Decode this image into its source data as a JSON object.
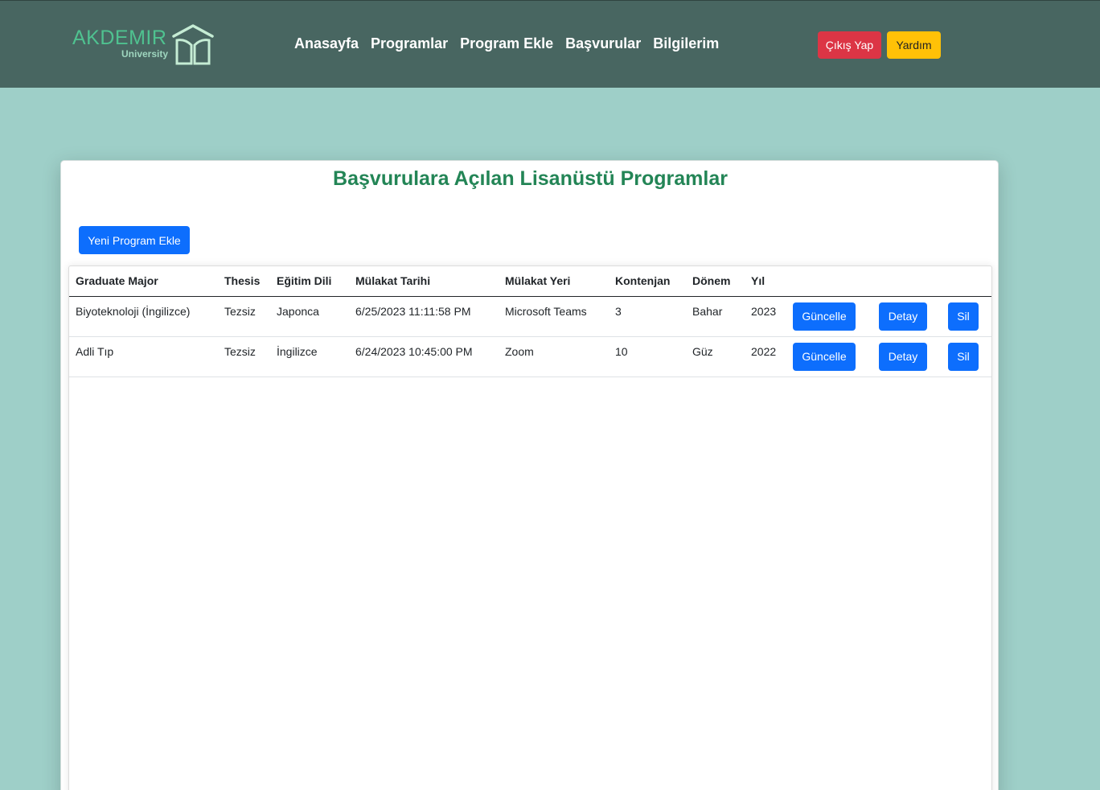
{
  "header": {
    "logo_text": "AKDEMIR",
    "logo_sub": "University",
    "nav": [
      "Anasayfa",
      "Programlar",
      "Program Ekle",
      "Başvurular",
      "Bilgilerim"
    ],
    "logout_label": "Çıkış Yap",
    "help_label": "Yardım"
  },
  "main": {
    "title": "Başvurulara Açılan Lisanüstü Programlar",
    "add_button": "Yeni Program Ekle",
    "table": {
      "columns": [
        "Graduate Major",
        "Thesis",
        "Eğitim Dili",
        "Mülakat Tarihi",
        "Mülakat Yeri",
        "Kontenjan",
        "Dönem",
        "Yıl"
      ],
      "rows": [
        {
          "major": "Biyoteknoloji (İngilizce)",
          "thesis": "Tezsiz",
          "language": "Japonca",
          "date": "6/25/2023 11:11:58 PM",
          "place": "Microsoft Teams",
          "quota": "3",
          "term": "Bahar",
          "year": "2023"
        },
        {
          "major": "Adli Tıp",
          "thesis": "Tezsiz",
          "language": "İngilizce",
          "date": "6/24/2023 10:45:00 PM",
          "place": "Zoom",
          "quota": "10",
          "term": "Güz",
          "year": "2022"
        }
      ],
      "row_actions": {
        "update": "Güncelle",
        "detail": "Detay",
        "delete": "Sil"
      }
    }
  },
  "colors": {
    "navbar": "#486661",
    "page_bg": "#9ecfc8",
    "title": "#238556",
    "primary": "#0d6efd",
    "danger": "#dc3545",
    "warning": "#ffc107"
  }
}
